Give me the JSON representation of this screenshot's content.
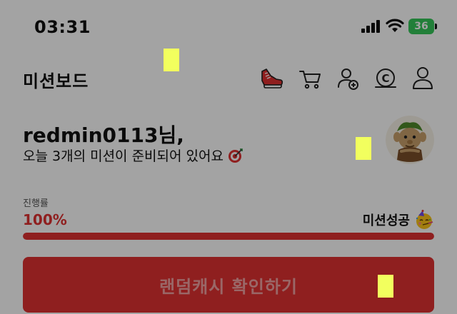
{
  "status_bar": {
    "time": "03:31",
    "battery_level": "36",
    "icons": [
      "cellular-signal-icon",
      "wifi-icon",
      "battery-charging-icon"
    ]
  },
  "header": {
    "title": "미션보드",
    "icons": [
      "sneaker-icon",
      "shopping-cart-icon",
      "add-friend-icon",
      "cash-coin-icon",
      "profile-icon"
    ]
  },
  "greeting": {
    "name": "redmin0113님,",
    "subtitle": "오늘 3개의 미션이 준비되어 있어요",
    "subtitle_icon": "target-dart-icon"
  },
  "avatar": {
    "icon": "goblin-character-avatar"
  },
  "progress": {
    "label": "진행률",
    "value_text": "100%",
    "value": 1.0,
    "status_text": "미션성공",
    "status_icon": "party-face-icon"
  },
  "cta": {
    "label": "랜덤캐시 확인하기"
  },
  "colors": {
    "accent": "#e03131",
    "battery": "#36c759",
    "overlay": "rgba(0,0,0,0.36)",
    "marker": "#f2ff5e"
  }
}
